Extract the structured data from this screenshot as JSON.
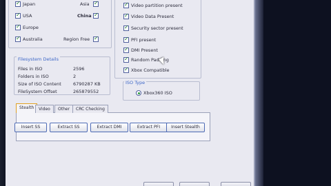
{
  "regions": {
    "items": [
      {
        "label": "Japan",
        "checked": true
      },
      {
        "label": "USA",
        "checked": true
      },
      {
        "label": "Europe",
        "checked": true
      },
      {
        "label": "Australia",
        "checked": true
      }
    ],
    "side": [
      {
        "label": "Asia",
        "checked": true
      },
      {
        "label": "China",
        "checked": true
      },
      {
        "label": "Region Free",
        "checked": true
      }
    ]
  },
  "flags": [
    {
      "label": "Video partition present",
      "checked": true
    },
    {
      "label": "Video Data Present",
      "checked": true
    },
    {
      "label": "Security sector present",
      "checked": true
    },
    {
      "label": "PFI present",
      "checked": true
    },
    {
      "label": "DMI Present",
      "checked": true
    },
    {
      "label": "Random Padding",
      "checked": true
    },
    {
      "label": "Xbox Compatible",
      "checked": true
    }
  ],
  "filesystem": {
    "title": "Filesystem Details",
    "rows": [
      {
        "label": "Files in ISO",
        "value": "2596"
      },
      {
        "label": "Folders in ISO",
        "value": "2"
      },
      {
        "label": "Size of ISO Content",
        "value": "6790287 KB"
      },
      {
        "label": "FileSystem Offset",
        "value": "265879552"
      }
    ]
  },
  "iso_type": {
    "title": "ISO Type",
    "option": "Xbox360 ISO"
  },
  "tabs": [
    {
      "label": "Stealth",
      "active": true
    },
    {
      "label": "Video",
      "active": false
    },
    {
      "label": "Other",
      "active": false
    },
    {
      "label": "CRC Checking",
      "active": false
    }
  ],
  "buttons": [
    {
      "label": "Insert SS"
    },
    {
      "label": "Extract SS"
    },
    {
      "label": "Extract DMI"
    },
    {
      "label": "Extract PFI"
    },
    {
      "label": "Insert Stealth"
    }
  ],
  "colors": {
    "accent_blue": "#3d67c8",
    "check_green": "#1d7a2a",
    "active_tab_border": "#e0a020"
  }
}
